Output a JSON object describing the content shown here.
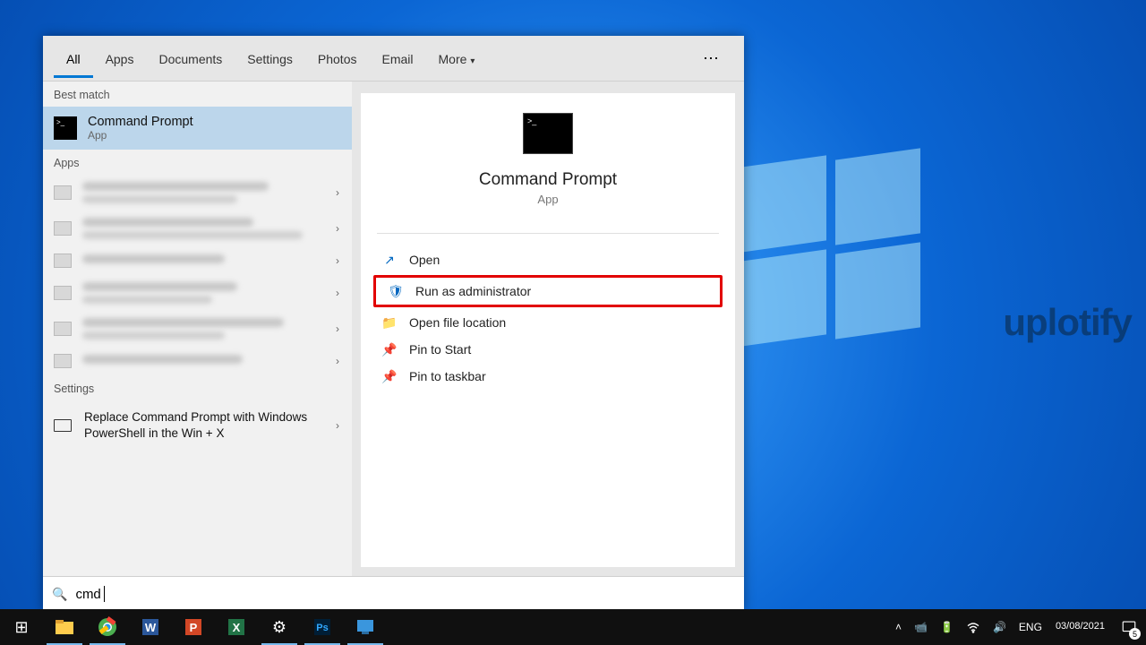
{
  "search": {
    "query": "cmd",
    "tabs": [
      "All",
      "Apps",
      "Documents",
      "Settings",
      "Photos",
      "Email",
      "More"
    ],
    "section_best": "Best match",
    "section_apps": "Apps",
    "section_settings": "Settings",
    "best_match": {
      "title": "Command Prompt",
      "subtitle": "App"
    },
    "setting_item": "Replace Command Prompt with Windows PowerShell in the Win + X",
    "preview": {
      "title": "Command Prompt",
      "subtitle": "App"
    },
    "actions": {
      "open": "Open",
      "run_admin": "Run as administrator",
      "open_loc": "Open file location",
      "pin_start": "Pin to Start",
      "pin_taskbar": "Pin to taskbar"
    }
  },
  "tray": {
    "lang": "ENG",
    "time": "",
    "date": "03/08/2021",
    "notif_count": "5"
  },
  "watermark": "uplotify"
}
